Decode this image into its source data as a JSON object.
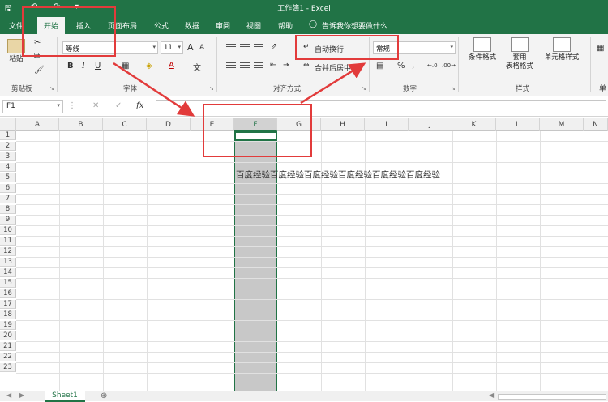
{
  "app": {
    "title": "工作簿1 - Excel",
    "tell_me": "告诉我你想要做什么"
  },
  "tabs": [
    "文件",
    "开始",
    "插入",
    "页面布局",
    "公式",
    "数据",
    "审阅",
    "视图",
    "帮助"
  ],
  "ribbon": {
    "clipboard": {
      "paste": "粘贴",
      "label": "剪贴板"
    },
    "font": {
      "name": "等线",
      "size": "11",
      "grow": "A",
      "shrink": "A",
      "bold": "B",
      "italic": "I",
      "underline": "U",
      "wen": "文",
      "label": "字体"
    },
    "alignment": {
      "wrap_text": "自动换行",
      "merge_center": "合并后居中",
      "label": "对齐方式"
    },
    "number": {
      "format": "常规",
      "percent": "%",
      "label": "数字"
    },
    "styles": {
      "conditional": "条件格式",
      "table_line1": "套用",
      "table_line2": "表格格式",
      "cell_styles": "单元格样式",
      "label": "样式"
    },
    "overflow": "单"
  },
  "formula_bar": {
    "name_box": "F1",
    "fx": "fx"
  },
  "columns": [
    "A",
    "B",
    "C",
    "D",
    "E",
    "F",
    "G",
    "H",
    "I",
    "J",
    "K",
    "L",
    "M",
    "N"
  ],
  "rows": [
    "1",
    "2",
    "3",
    "4",
    "5",
    "6",
    "7",
    "8",
    "9",
    "10",
    "11",
    "12",
    "13",
    "14",
    "15",
    "16",
    "17",
    "18",
    "19",
    "20",
    "21",
    "22",
    "23"
  ],
  "cells": {
    "F4": "百度经验百度经验百度经验百度经验百度经验百度经验"
  },
  "sheets": [
    "Sheet1"
  ],
  "colors": {
    "accent": "#217346",
    "annotation": "#e23b3b"
  }
}
